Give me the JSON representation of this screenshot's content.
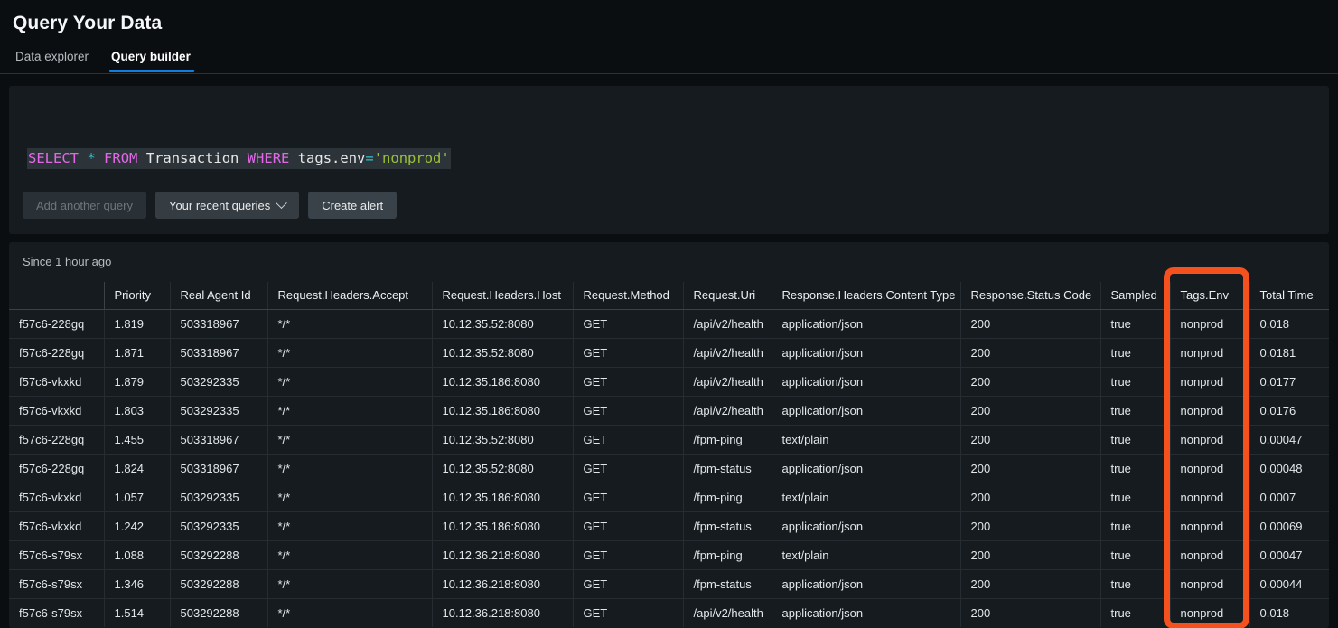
{
  "header": {
    "title": "Query Your Data",
    "tabs": [
      {
        "label": "Data explorer",
        "active": false
      },
      {
        "label": "Query builder",
        "active": true
      }
    ]
  },
  "query_panel": {
    "query_tokens": [
      {
        "text": "SELECT",
        "type": "keyword"
      },
      {
        "text": " ",
        "type": "plain"
      },
      {
        "text": "*",
        "type": "operator"
      },
      {
        "text": " ",
        "type": "plain"
      },
      {
        "text": "FROM",
        "type": "keyword"
      },
      {
        "text": " ",
        "type": "plain"
      },
      {
        "text": "Transaction",
        "type": "identifier"
      },
      {
        "text": " ",
        "type": "plain"
      },
      {
        "text": "WHERE",
        "type": "keyword"
      },
      {
        "text": " ",
        "type": "plain"
      },
      {
        "text": "tags.env",
        "type": "identifier"
      },
      {
        "text": "=",
        "type": "operator"
      },
      {
        "text": "'nonprod'",
        "type": "string"
      }
    ],
    "query_text": "SELECT * FROM Transaction WHERE tags.env='nonprod'",
    "buttons": {
      "add_another_query": "Add another query",
      "recent_queries": "Your recent queries",
      "create_alert": "Create alert"
    }
  },
  "results_panel": {
    "time_range": "Since 1 hour ago",
    "columns": [
      "",
      "Priority",
      "Real Agent Id",
      "Request.Headers.Accept",
      "Request.Headers.Host",
      "Request.Method",
      "Request.Uri",
      "Response.Headers.Content Type",
      "Response.Status Code",
      "Sampled",
      "Tags.Env",
      "Total Time"
    ],
    "rows": [
      [
        "f57c6-228gq",
        "1.819",
        "503318967",
        "*/*",
        "10.12.35.52:8080",
        "GET",
        "/api/v2/health",
        "application/json",
        "200",
        "true",
        "nonprod",
        "0.018"
      ],
      [
        "f57c6-228gq",
        "1.871",
        "503318967",
        "*/*",
        "10.12.35.52:8080",
        "GET",
        "/api/v2/health",
        "application/json",
        "200",
        "true",
        "nonprod",
        "0.0181"
      ],
      [
        "f57c6-vkxkd",
        "1.879",
        "503292335",
        "*/*",
        "10.12.35.186:8080",
        "GET",
        "/api/v2/health",
        "application/json",
        "200",
        "true",
        "nonprod",
        "0.0177"
      ],
      [
        "f57c6-vkxkd",
        "1.803",
        "503292335",
        "*/*",
        "10.12.35.186:8080",
        "GET",
        "/api/v2/health",
        "application/json",
        "200",
        "true",
        "nonprod",
        "0.0176"
      ],
      [
        "f57c6-228gq",
        "1.455",
        "503318967",
        "*/*",
        "10.12.35.52:8080",
        "GET",
        "/fpm-ping",
        "text/plain",
        "200",
        "true",
        "nonprod",
        "0.00047"
      ],
      [
        "f57c6-228gq",
        "1.824",
        "503318967",
        "*/*",
        "10.12.35.52:8080",
        "GET",
        "/fpm-status",
        "application/json",
        "200",
        "true",
        "nonprod",
        "0.00048"
      ],
      [
        "f57c6-vkxkd",
        "1.057",
        "503292335",
        "*/*",
        "10.12.35.186:8080",
        "GET",
        "/fpm-ping",
        "text/plain",
        "200",
        "true",
        "nonprod",
        "0.0007"
      ],
      [
        "f57c6-vkxkd",
        "1.242",
        "503292335",
        "*/*",
        "10.12.35.186:8080",
        "GET",
        "/fpm-status",
        "application/json",
        "200",
        "true",
        "nonprod",
        "0.00069"
      ],
      [
        "f57c6-s79sx",
        "1.088",
        "503292288",
        "*/*",
        "10.12.36.218:8080",
        "GET",
        "/fpm-ping",
        "text/plain",
        "200",
        "true",
        "nonprod",
        "0.00047"
      ],
      [
        "f57c6-s79sx",
        "1.346",
        "503292288",
        "*/*",
        "10.12.36.218:8080",
        "GET",
        "/fpm-status",
        "application/json",
        "200",
        "true",
        "nonprod",
        "0.00044"
      ],
      [
        "f57c6-s79sx",
        "1.514",
        "503292288",
        "*/*",
        "10.12.36.218:8080",
        "GET",
        "/api/v2/health",
        "application/json",
        "200",
        "true",
        "nonprod",
        "0.018"
      ]
    ]
  },
  "annotation": {
    "highlight_color": "#f4511e",
    "highlights_column": "Tags.Env"
  },
  "colors": {
    "background": "#0a0e11",
    "panel": "#151b1f",
    "accent": "#0e7fe1",
    "keyword": "#e368e7",
    "operator": "#2bc4c9",
    "string": "#9ac334"
  }
}
